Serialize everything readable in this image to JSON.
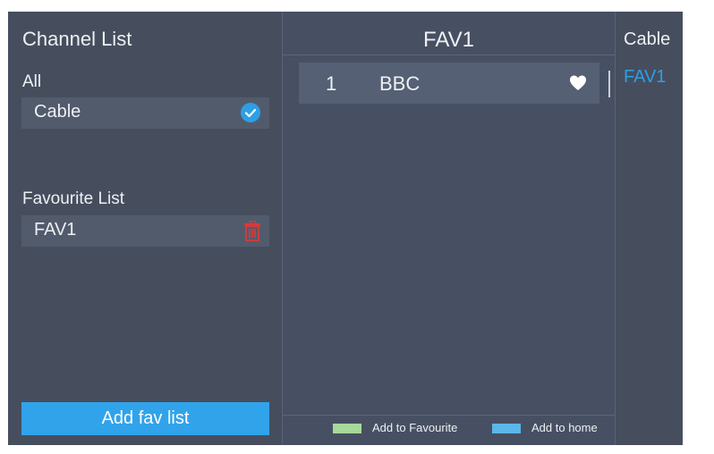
{
  "left_panel": {
    "title": "Channel List",
    "all_label": "All",
    "all_items": [
      {
        "label": "Cable",
        "selected": true,
        "icon": "check-circle-icon"
      }
    ],
    "favourite_label": "Favourite List",
    "favourite_items": [
      {
        "label": "FAV1",
        "icon": "trash-icon"
      }
    ],
    "add_button_label": "Add fav list"
  },
  "middle_panel": {
    "title": "FAV1",
    "channels": [
      {
        "number": "1",
        "name": "BBC",
        "icon": "heart-icon"
      }
    ],
    "legend": [
      {
        "label": "Add to Favourite",
        "color": "#a7d99b"
      },
      {
        "label": "Add to home",
        "color": "#5cb6ea"
      }
    ]
  },
  "right_panel": {
    "items": [
      {
        "label": "Cable",
        "active": false
      },
      {
        "label": "FAV1",
        "active": true
      }
    ]
  },
  "colors": {
    "background": "#464e5e",
    "accent": "#2d9fe6",
    "delete": "#d9393b"
  }
}
